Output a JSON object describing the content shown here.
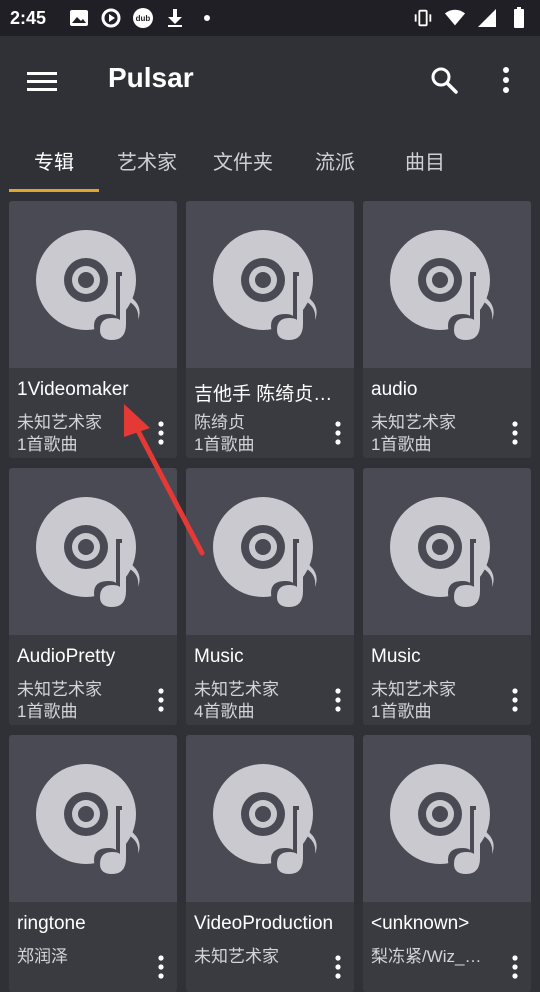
{
  "status": {
    "time": "2:45",
    "left_icons": [
      "image-icon",
      "sync-icon",
      "dub-icon",
      "download-icon",
      "dot-icon"
    ],
    "right_icons": [
      "vibrate-icon",
      "wifi-icon",
      "signal-icon",
      "battery-icon"
    ],
    "dub_label": "dub"
  },
  "appbar": {
    "title": "Pulsar"
  },
  "tabs": [
    {
      "label": "专辑",
      "active": true
    },
    {
      "label": "艺术家",
      "active": false
    },
    {
      "label": "文件夹",
      "active": false
    },
    {
      "label": "流派",
      "active": false
    },
    {
      "label": "曲目",
      "active": false
    }
  ],
  "albums": [
    {
      "title": "1Videomaker",
      "artist": "未知艺术家",
      "count": "1首歌曲"
    },
    {
      "title": "吉他手 陈绮贞…",
      "artist": "陈绮贞",
      "count": "1首歌曲"
    },
    {
      "title": "audio",
      "artist": "未知艺术家",
      "count": "1首歌曲"
    },
    {
      "title": "AudioPretty",
      "artist": "未知艺术家",
      "count": "1首歌曲"
    },
    {
      "title": "Music",
      "artist": "未知艺术家",
      "count": "4首歌曲"
    },
    {
      "title": "Music",
      "artist": "未知艺术家",
      "count": "1首歌曲"
    },
    {
      "title": "ringtone",
      "artist": "郑润泽",
      "count": ""
    },
    {
      "title": "VideoProduction",
      "artist": "未知艺术家",
      "count": ""
    },
    {
      "title": "<unknown>",
      "artist": "梨冻紧/Wiz_…",
      "count": ""
    }
  ],
  "colors": {
    "background": "#303037",
    "accent": "#e0a52c",
    "annotation_arrow": "#e53935"
  }
}
